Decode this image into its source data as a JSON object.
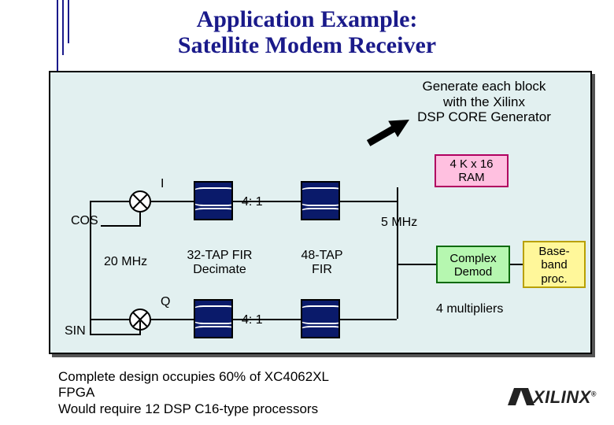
{
  "title_line1": "Application Example:",
  "title_line2": "Satellite Modem Receiver",
  "note_line1": "Generate each block",
  "note_line2": "with the Xilinx",
  "note_line3": "DSP CORE Generator",
  "ram_line1": "4 K x 16",
  "ram_line2": "RAM",
  "labels": {
    "I": "I",
    "Q": "Q",
    "cos": "COS",
    "sin": "SIN",
    "rate_in": "20 MHz",
    "rate_mid": "5 MHz",
    "decimate1": "4: 1",
    "decimate2": "4: 1",
    "fir1_line1": "32-TAP FIR",
    "fir1_line2": "Decimate",
    "fir2_line1": "48-TAP",
    "fir2_line2": "FIR",
    "demod_line1": "Complex",
    "demod_line2": "Demod",
    "bb_line1": "Base-",
    "bb_line2": "band",
    "bb_line3": "proc.",
    "multipliers": "4 multipliers"
  },
  "footer_line1": "Complete design occupies 60% of XC4062XL",
  "footer_line2": "FPGA",
  "footer_line3": " Would require 12 DSP C16-type processors",
  "brand": "XILINX",
  "tm": "®"
}
